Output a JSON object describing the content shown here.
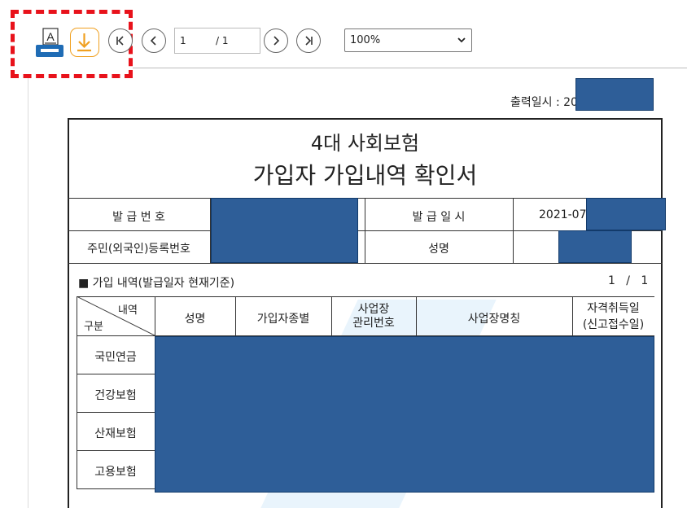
{
  "toolbar": {
    "print_icon_letter": "A",
    "page_current": "1",
    "page_total": "/ 1",
    "zoom_value": "100%",
    "icons": [
      "print-icon",
      "download-icon",
      "first-page-icon",
      "prev-page-icon",
      "next-page-icon",
      "last-page-icon",
      "chevron-down-icon"
    ],
    "highlight_color": "#e8121b"
  },
  "document": {
    "print_time_label": "출력일시 : 20",
    "title_line1": "4대 사회보험",
    "title_line2": "가입자 가입내역 확인서",
    "issue_number_label": "발 급 번 호",
    "issue_date_label": "발 급 일 시",
    "issue_date_value": "2021-07-",
    "resident_number_label": "주민(외국인)등록번호",
    "name_label": "성명",
    "section_title": "■ 가입 내역(발급일자 현재기준)",
    "page_count": "1   /   1",
    "table": {
      "corner_top": "내역",
      "corner_bottom": "구분",
      "columns": [
        "성명",
        "가입자종별",
        "사업장\n관리번호",
        "사업장명칭",
        "자격취득일\n(신고접수일)"
      ],
      "column_1": "성명",
      "column_2": "가입자종별",
      "column_3_line1": "사업장",
      "column_3_line2": "관리번호",
      "column_4": "사업장명칭",
      "column_5_line1": "자격취득일",
      "column_5_line2": "(신고접수일)",
      "rows": [
        "국민연금",
        "건강보험",
        "산재보험",
        "고용보험"
      ]
    },
    "redaction_color": "#2e5e98"
  }
}
